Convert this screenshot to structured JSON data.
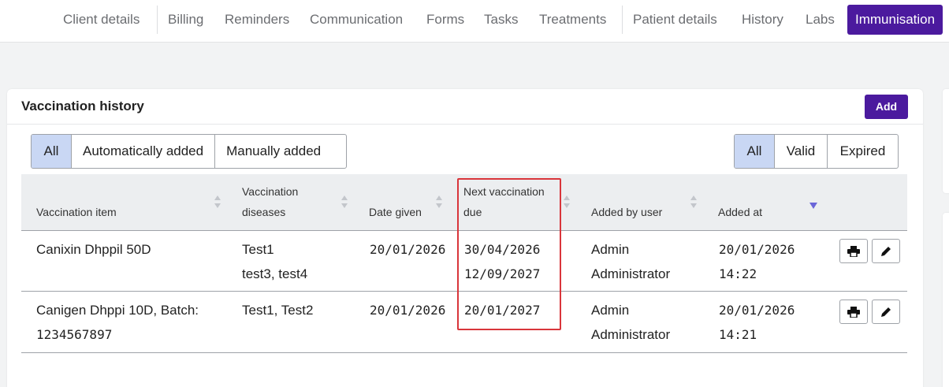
{
  "nav": {
    "tabs": [
      {
        "label": "Client details",
        "active": false
      },
      {
        "label": "Billing",
        "active": false
      },
      {
        "label": "Reminders",
        "active": false
      },
      {
        "label": "Communication",
        "active": false
      },
      {
        "label": "Forms",
        "active": false
      },
      {
        "label": "Tasks",
        "active": false
      },
      {
        "label": "Treatments",
        "active": false
      },
      {
        "label": "Patient details",
        "active": false
      },
      {
        "label": "History",
        "active": false
      },
      {
        "label": "Labs",
        "active": false
      },
      {
        "label": "Immunisation",
        "active": true
      }
    ]
  },
  "card": {
    "title": "Vaccination history",
    "add_label": "Add"
  },
  "source_filter": {
    "options": [
      "All",
      "Automatically added",
      "Manually added"
    ],
    "selected": "All"
  },
  "validity_filter": {
    "options": [
      "All",
      "Valid",
      "Expired"
    ],
    "selected": "All"
  },
  "table": {
    "columns": [
      {
        "line1": "",
        "line2": "Vaccination item"
      },
      {
        "line1": "Vaccination",
        "line2": "diseases"
      },
      {
        "line1": "",
        "line2": "Date given"
      },
      {
        "line1": "Next vaccination",
        "line2": "due"
      },
      {
        "line1": "",
        "line2": "Added by user"
      },
      {
        "line1": "",
        "line2": "Added at"
      }
    ],
    "sorted_column": "Added at",
    "sort_direction": "descending",
    "rows": [
      {
        "item": [
          "Canixin Dhppil 50D",
          ""
        ],
        "diseases": [
          "Test1",
          "test3, test4"
        ],
        "date_given": "20/01/2026",
        "next_due": [
          "30/04/2026",
          "12/09/2027"
        ],
        "added_by": [
          "Admin",
          "Administrator"
        ],
        "added_at": [
          "20/01/2026",
          "14:22"
        ]
      },
      {
        "item": [
          "Canigen Dhppi 10D, Batch:",
          "1234567897"
        ],
        "diseases": [
          "Test1, Test2",
          ""
        ],
        "date_given": "20/01/2026",
        "next_due": [
          "20/01/2027",
          ""
        ],
        "added_by": [
          "Admin",
          "Administrator"
        ],
        "added_at": [
          "20/01/2026",
          "14:21"
        ]
      }
    ],
    "row_actions": [
      "print-icon",
      "pencil-icon"
    ]
  },
  "colors": {
    "accent": "#4b1a9e",
    "selected_filter": "#c9d7f4",
    "highlight_box": "#d9353b",
    "sort_indicator": "#6b66d8"
  }
}
